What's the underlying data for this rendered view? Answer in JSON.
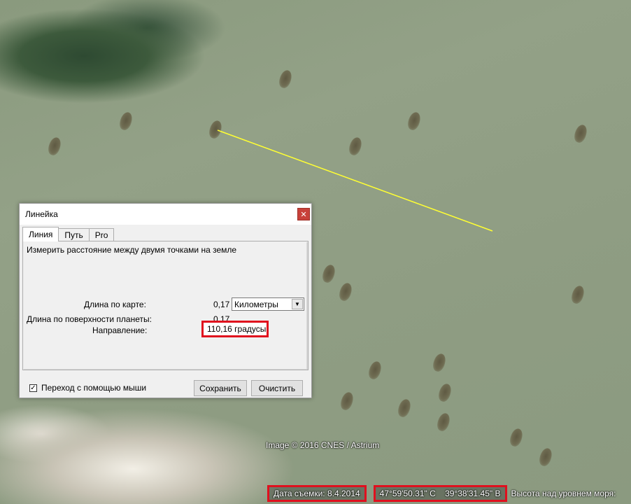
{
  "map": {
    "copyright": "Image © 2016 CNES / Astrium",
    "ruler_line_color": "#ffff33"
  },
  "statusbar": {
    "date": "Дата съемки: 8.4.2014",
    "coords": "47°59'50.31\" С    39°38'31.45\" В",
    "elevation_label": "Высота над уровнем моря:",
    "highlight_color": "#e0101e"
  },
  "dialog": {
    "title": "Линейка",
    "close_icon": "close-icon",
    "tabs": [
      {
        "label": "Линия",
        "active": true
      },
      {
        "label": "Путь",
        "active": false
      },
      {
        "label": "Pro",
        "active": false
      }
    ],
    "description": "Измерить расстояние между двумя точками на земле",
    "map_length_label": "Длина по карте:",
    "map_length_value": "0,17",
    "units_selected": "Километры",
    "surface_length_label": "Длина по поверхности планеты:",
    "surface_length_value": "0,17",
    "direction_label": "Направление:",
    "direction_value": "110,16 градусы",
    "mouse_nav_label": "Переход с помощью мыши",
    "mouse_nav_checked": true,
    "save_label": "Сохранить",
    "clear_label": "Очистить"
  }
}
